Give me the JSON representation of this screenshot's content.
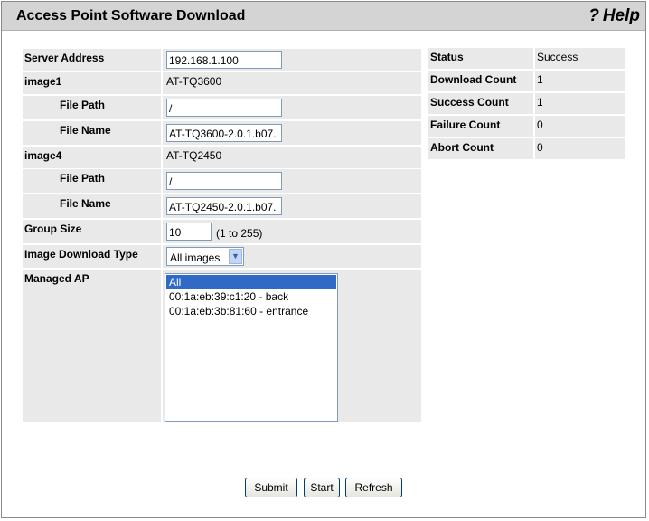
{
  "header": {
    "title": "Access Point Software Download",
    "help_label": "Help",
    "help_icon": "?"
  },
  "form": {
    "server_address": {
      "label": "Server Address",
      "value": "192.168.1.100"
    },
    "image1": {
      "label": "image1",
      "model": "AT-TQ3600",
      "file_path": {
        "label": "File Path",
        "value": "/"
      },
      "file_name": {
        "label": "File Name",
        "value": "AT-TQ3600-2.0.1.b07."
      }
    },
    "image4": {
      "label": "image4",
      "model": "AT-TQ2450",
      "file_path": {
        "label": "File Path",
        "value": "/"
      },
      "file_name": {
        "label": "File Name",
        "value": "AT-TQ2450-2.0.1.b07."
      }
    },
    "group_size": {
      "label": "Group Size",
      "value": "10",
      "hint": "(1 to 255)"
    },
    "image_download_type": {
      "label": "Image Download Type",
      "selected": "All images"
    },
    "managed_ap": {
      "label": "Managed AP",
      "options": [
        "All",
        "00:1a:eb:39:c1:20 - back",
        "00:1a:eb:3b:81:60 - entrance"
      ]
    }
  },
  "status": {
    "status": {
      "label": "Status",
      "value": "Success"
    },
    "download_count": {
      "label": "Download Count",
      "value": "1"
    },
    "success_count": {
      "label": "Success Count",
      "value": "1"
    },
    "failure_count": {
      "label": "Failure Count",
      "value": "0"
    },
    "abort_count": {
      "label": "Abort Count",
      "value": "0"
    }
  },
  "buttons": {
    "submit": "Submit",
    "start": "Start",
    "refresh": "Refresh"
  },
  "colors": {
    "header_bg": "#d4d4d4",
    "row_bg": "#e9e9e9",
    "selection": "#316ac5"
  }
}
